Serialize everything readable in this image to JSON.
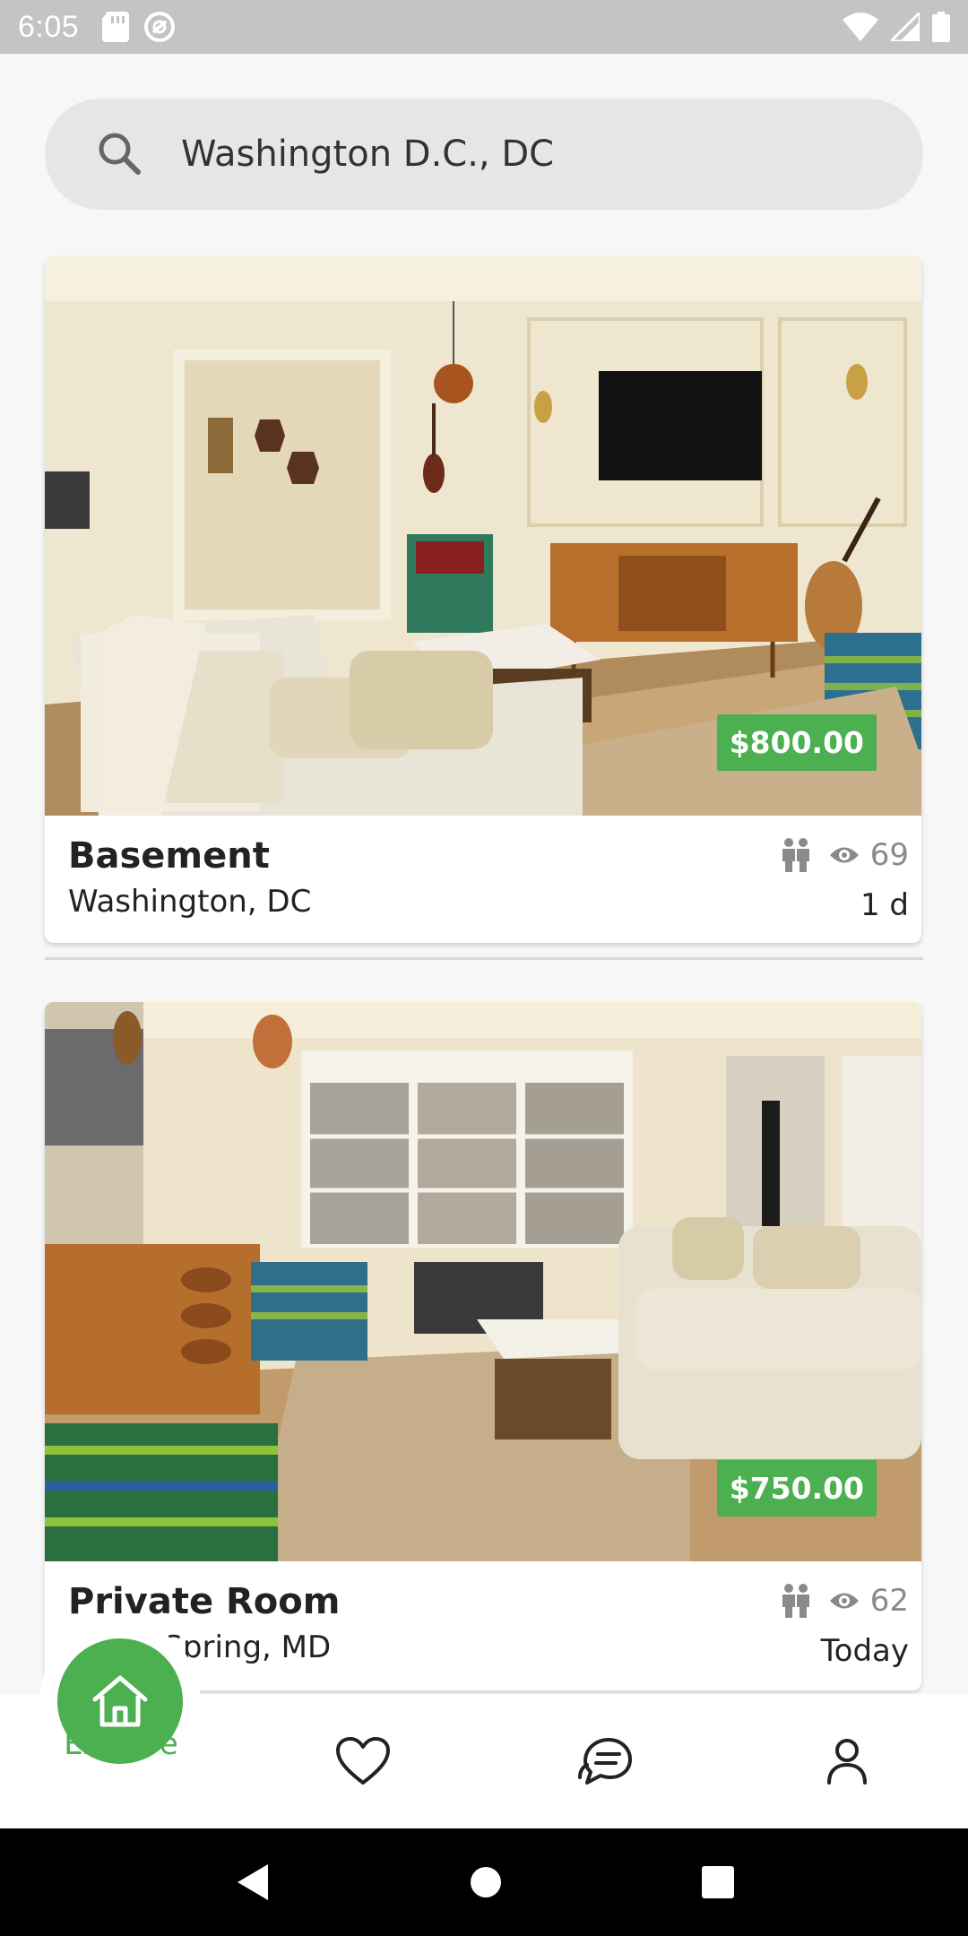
{
  "status_bar": {
    "time": "6:05"
  },
  "search": {
    "value": "Washington D.C., DC"
  },
  "listings": [
    {
      "title": "Basement",
      "location": "Washington, DC",
      "price": "$800.00",
      "views": "69",
      "age": "1 d"
    },
    {
      "title": "Private Room",
      "location": "Silver Spring, MD",
      "price": "$750.00",
      "views": "62",
      "age": "Today"
    }
  ],
  "bottom_nav": {
    "explore_label": "Explore",
    "items": [
      "home-icon",
      "heart-icon",
      "chat-icon",
      "profile-icon"
    ]
  },
  "colors": {
    "accent": "#4caf50",
    "status_bar": "#c4c4c4",
    "search_bg": "#e6e6e6"
  }
}
